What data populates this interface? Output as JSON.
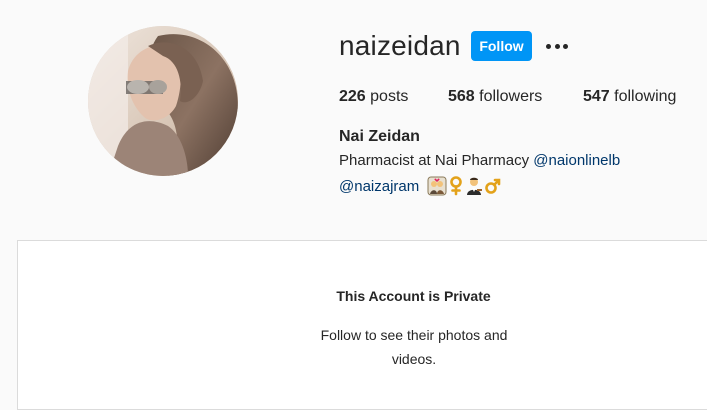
{
  "profile": {
    "username": "naizeidan",
    "follow_label": "Follow",
    "more_icon": "more-horizontal-icon",
    "stats": {
      "posts_count": "226",
      "posts_label": "posts",
      "followers_count": "568",
      "followers_label": "followers",
      "following_count": "547",
      "following_label": "following"
    },
    "full_name": "Nai Zeidan",
    "bio": {
      "text": "Pharmacist at Nai Pharmacy",
      "mention_1": "@naionlinelb",
      "mention_2": "@naizajram",
      "emojis": [
        "couple-with-heart-emoji",
        "female-sign-emoji",
        "man-judge-emoji",
        "male-sign-emoji"
      ]
    }
  },
  "private_notice": {
    "title": "This Account is Private",
    "subtitle": "Follow to see their photos and videos."
  },
  "colors": {
    "accent": "#0095f6",
    "link": "#00376b",
    "text": "#262626",
    "background": "#fafafa",
    "border": "#dbdbdb"
  }
}
